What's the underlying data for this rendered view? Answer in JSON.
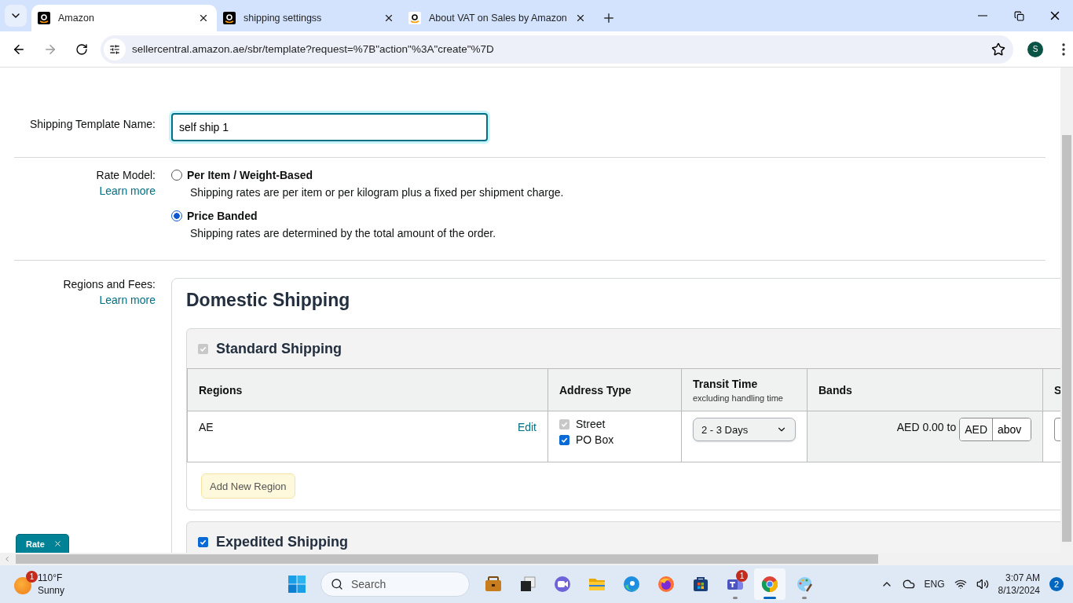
{
  "browser": {
    "tabs": [
      {
        "title": "Amazon",
        "selected": true,
        "kind": "dark"
      },
      {
        "title": "shipping settingss",
        "selected": false,
        "kind": "dark"
      },
      {
        "title": "About VAT on Sales by Amazon",
        "selected": false,
        "kind": "light"
      }
    ],
    "url": "sellercentral.amazon.ae/sbr/template?request=%7B\"action\"%3A\"create\"%7D",
    "profile": "S"
  },
  "template": {
    "label": "Shipping Template Name:",
    "value": "self ship 1"
  },
  "rate_model": {
    "label": "Rate Model:",
    "learn_more": "Learn more",
    "options": [
      {
        "label": "Per Item / Weight-Based",
        "description": "Shipping rates are per item or per kilogram plus a fixed per shipment charge.",
        "selected": false
      },
      {
        "label": "Price Banded",
        "description": "Shipping rates are determined by the total amount of the order.",
        "selected": true
      }
    ]
  },
  "regions": {
    "label": "Regions and Fees:",
    "learn_more": "Learn more",
    "title": "Domestic Shipping",
    "sections": [
      {
        "title": "Standard Shipping",
        "checked": true,
        "disabled": true,
        "columns": [
          {
            "label": "Regions"
          },
          {
            "label": "Address Type"
          },
          {
            "label": "Transit Time",
            "sublabel": "excluding handling time"
          },
          {
            "label": "Bands"
          },
          {
            "label": "S"
          }
        ],
        "rows": [
          {
            "region": "AE",
            "edit": "Edit",
            "address_types": [
              {
                "label": "Street",
                "checked": true,
                "disabled": true
              },
              {
                "label": "PO Box",
                "checked": true,
                "disabled": false
              }
            ],
            "transit": "2 - 3 Days",
            "band_from": "AED 0.00 to",
            "currency": "AED",
            "band_to": "abov"
          }
        ],
        "add_button": "Add New Region"
      },
      {
        "title": "Expedited Shipping",
        "checked": true,
        "disabled": false
      }
    ]
  },
  "feedback_tab": {
    "label": "Rate"
  },
  "taskbar": {
    "weather": {
      "temp": "110°F",
      "condition": "Sunny",
      "badge": "1"
    },
    "search": {
      "placeholder": "Search"
    },
    "apps": [
      {
        "kind": "briefcase",
        "running": false,
        "selected": false
      },
      {
        "kind": "taskview",
        "running": false,
        "selected": false
      },
      {
        "kind": "meet",
        "running": false,
        "selected": false
      },
      {
        "kind": "folder",
        "running": false,
        "selected": false
      },
      {
        "kind": "edge",
        "running": false,
        "selected": false
      },
      {
        "kind": "firefox",
        "running": false,
        "selected": false
      },
      {
        "kind": "store",
        "running": false,
        "selected": false
      },
      {
        "kind": "teams",
        "running": true,
        "selected": false,
        "badge": "1"
      },
      {
        "kind": "chrome",
        "running": true,
        "selected": true
      },
      {
        "kind": "paint",
        "running": true,
        "selected": false
      }
    ],
    "language": "ENG",
    "time": "3:07 AM",
    "date": "8/13/2024",
    "notifications": "2"
  }
}
